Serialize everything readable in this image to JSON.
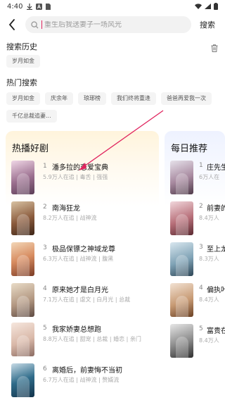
{
  "status_bar": {
    "time": "4:40"
  },
  "search": {
    "placeholder": "重生后我送妻子一场风光",
    "button_label": "搜索"
  },
  "history": {
    "title": "搜索历史",
    "items": [
      "岁月如金"
    ]
  },
  "hot_search": {
    "title": "热门搜索",
    "items": [
      "岁月如金",
      "庆余年",
      "琅琊榜",
      "我们终将重逢",
      "爸爸再爱我一次",
      "千亿总裁追妻..."
    ]
  },
  "hot_list": {
    "title": "热播好剧",
    "items": [
      {
        "rank": "1",
        "title": "潘多拉的恋爱宝典",
        "meta": "5.9万人在追 | 毒舌 | 强强"
      },
      {
        "rank": "2",
        "title": "南海狂龙",
        "meta": "8.2万人在追 | 战神流"
      },
      {
        "rank": "3",
        "title": "极品保镖之神域龙尊",
        "meta": "6.3万人在追 | 战神流 | 腹黑"
      },
      {
        "rank": "4",
        "title": "原来她才是白月光",
        "meta": "7.1万人在追 | 虐文 | 白月光 | 总裁"
      },
      {
        "rank": "5",
        "title": "我家娇妻总想跑",
        "meta": "8.8万人在追 | 甜宠 | 总裁 | 婚恋 | 亲门"
      },
      {
        "rank": "6",
        "title": "离婚后，前妻悔不当初",
        "meta": "6.7万人在追 | 战神流 | 赘婿流"
      }
    ]
  },
  "daily": {
    "title": "每日推荐",
    "items": [
      {
        "rank": "1",
        "title": "庄先生",
        "meta": "6万人在"
      },
      {
        "rank": "2",
        "title": "前妻的",
        "meta": "8.4万人"
      },
      {
        "rank": "3",
        "title": "至上龙",
        "meta": "8.3万人"
      },
      {
        "rank": "4",
        "title": "偏执叶",
        "meta": "8.4万人"
      },
      {
        "rank": "5",
        "title": "富贵在",
        "meta": "8.4万人"
      }
    ]
  },
  "colors": {
    "accent": "#e0245e",
    "hot_card_bg": "#fff4dc",
    "daily_card_bg": "#eef2ff"
  }
}
